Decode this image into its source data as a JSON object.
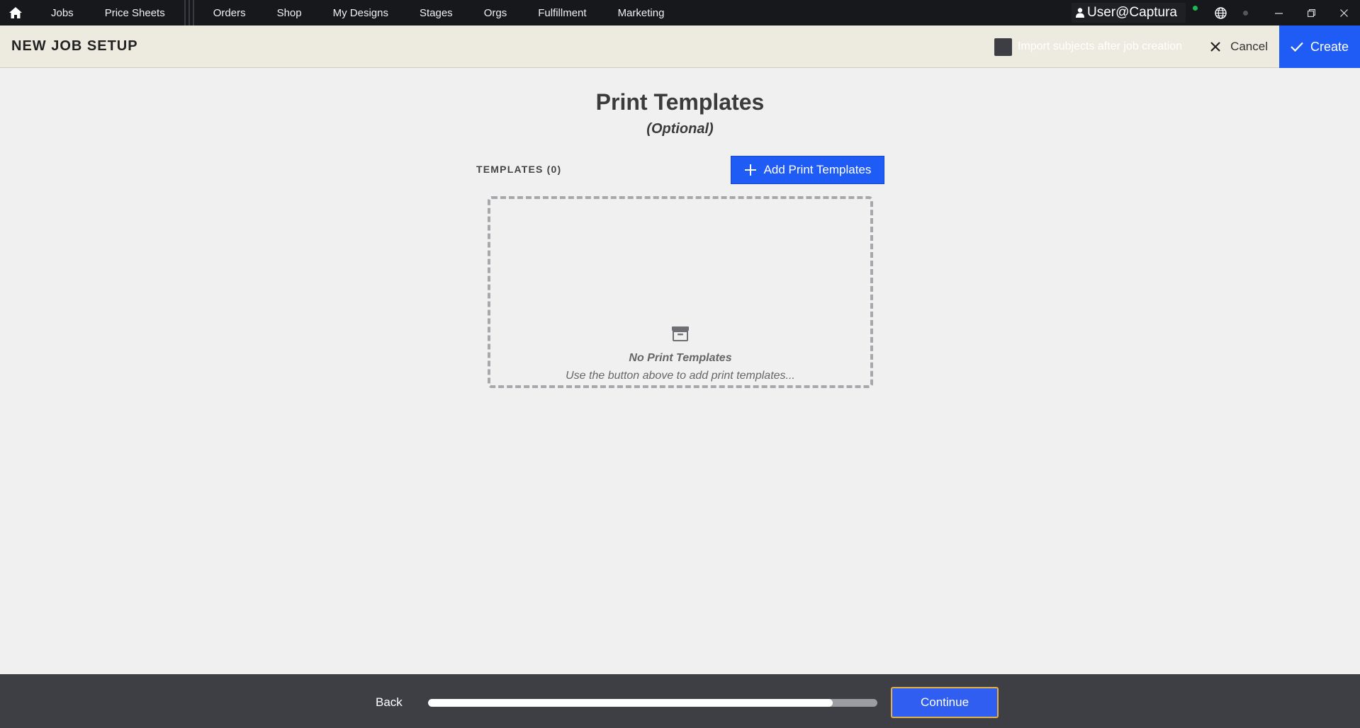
{
  "nav": {
    "items": [
      "Jobs",
      "Price Sheets",
      "Orders",
      "Shop",
      "My Designs",
      "Stages",
      "Orgs",
      "Fulfillment",
      "Marketing"
    ],
    "user": "User@Captura"
  },
  "header": {
    "title": "NEW JOB SETUP",
    "import_label": "Import subjects after job creation",
    "import_checked": false,
    "cancel_label": "Cancel",
    "create_label": "Create"
  },
  "main": {
    "title": "Print Templates",
    "subtitle": "(Optional)",
    "templates_label": "TEMPLATES (0)",
    "add_button_label": "Add Print Templates",
    "empty_title": "No Print Templates",
    "empty_subtitle": "Use the button above to add print templates..."
  },
  "footer": {
    "back_label": "Back",
    "continue_label": "Continue",
    "progress_fraction": 0.9
  },
  "colors": {
    "accent": "#1f5cf6",
    "topnav_bg": "#17181c",
    "header_bg": "#edebe0",
    "footer_bg": "#3e3f45",
    "continue_border": "#e3b04b"
  }
}
